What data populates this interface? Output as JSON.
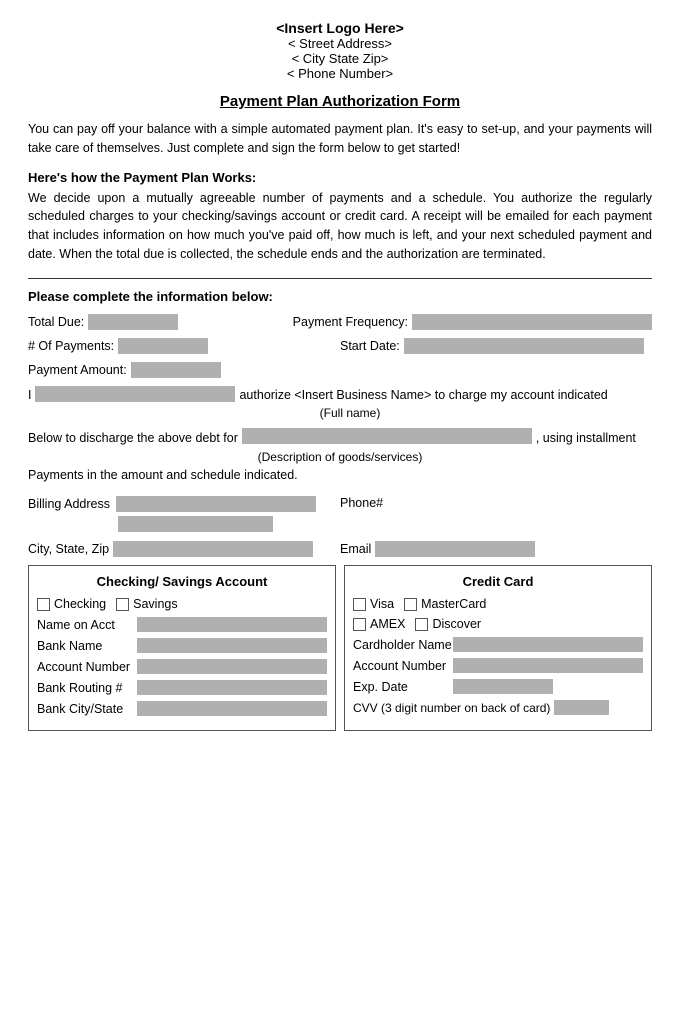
{
  "header": {
    "logo": "<Insert Logo Here>",
    "street": "< Street Address>",
    "city_state_zip": "< City State Zip>",
    "phone": "< Phone Number>"
  },
  "form_title": "Payment Plan Authorization Form",
  "intro": "You can pay off your balance with a simple automated payment plan.  It's easy to set-up, and your payments will take care of themselves.  Just complete and sign the form below to get started!",
  "how_it_works": {
    "title": "Here's how the Payment Plan Works:",
    "body": "We decide upon a mutually agreeable number of payments and a schedule.  You authorize the regularly scheduled charges to your checking/savings account or credit card.  A receipt will be emailed for each payment that includes information on how much you've paid off, how much is left, and your next scheduled payment and date.  When the total due is collected, the schedule ends and the authorization are terminated."
  },
  "complete_title": "Please complete the information below:",
  "fields": {
    "total_due_label": "Total Due:",
    "payment_frequency_label": "Payment Frequency:",
    "num_payments_label": "# Of Payments:",
    "start_date_label": "Start Date:",
    "payment_amount_label": "Payment Amount:",
    "authorize_prefix": "I",
    "full_name_label": "(Full name)",
    "authorize_suffix": "authorize <Insert Business Name> to charge my account indicated",
    "discharge_prefix": "Below to discharge the above debt for",
    "goods_label": "(Description of goods/services)",
    "discharge_suffix": ", using installment",
    "payments_text": "Payments in the amount and schedule indicated.",
    "billing_address_label": "Billing Address",
    "phone_label": "Phone#",
    "city_state_zip_label": "City, State, Zip",
    "email_label": "Email"
  },
  "checking_section": {
    "title": "Checking/ Savings Account",
    "checking_label": "Checking",
    "savings_label": "Savings",
    "name_on_acct_label": "Name on Acct",
    "bank_name_label": "Bank Name",
    "account_number_label": "Account Number",
    "bank_routing_label": "Bank Routing #",
    "bank_city_state_label": "Bank City/State"
  },
  "credit_section": {
    "title": "Credit Card",
    "visa_label": "Visa",
    "mastercard_label": "MasterCard",
    "amex_label": "AMEX",
    "discover_label": "Discover",
    "cardholder_name_label": "Cardholder Name",
    "account_number_label": "Account Number",
    "exp_date_label": "Exp. Date",
    "cvv_label": "CVV (3 digit number on back of card)"
  }
}
